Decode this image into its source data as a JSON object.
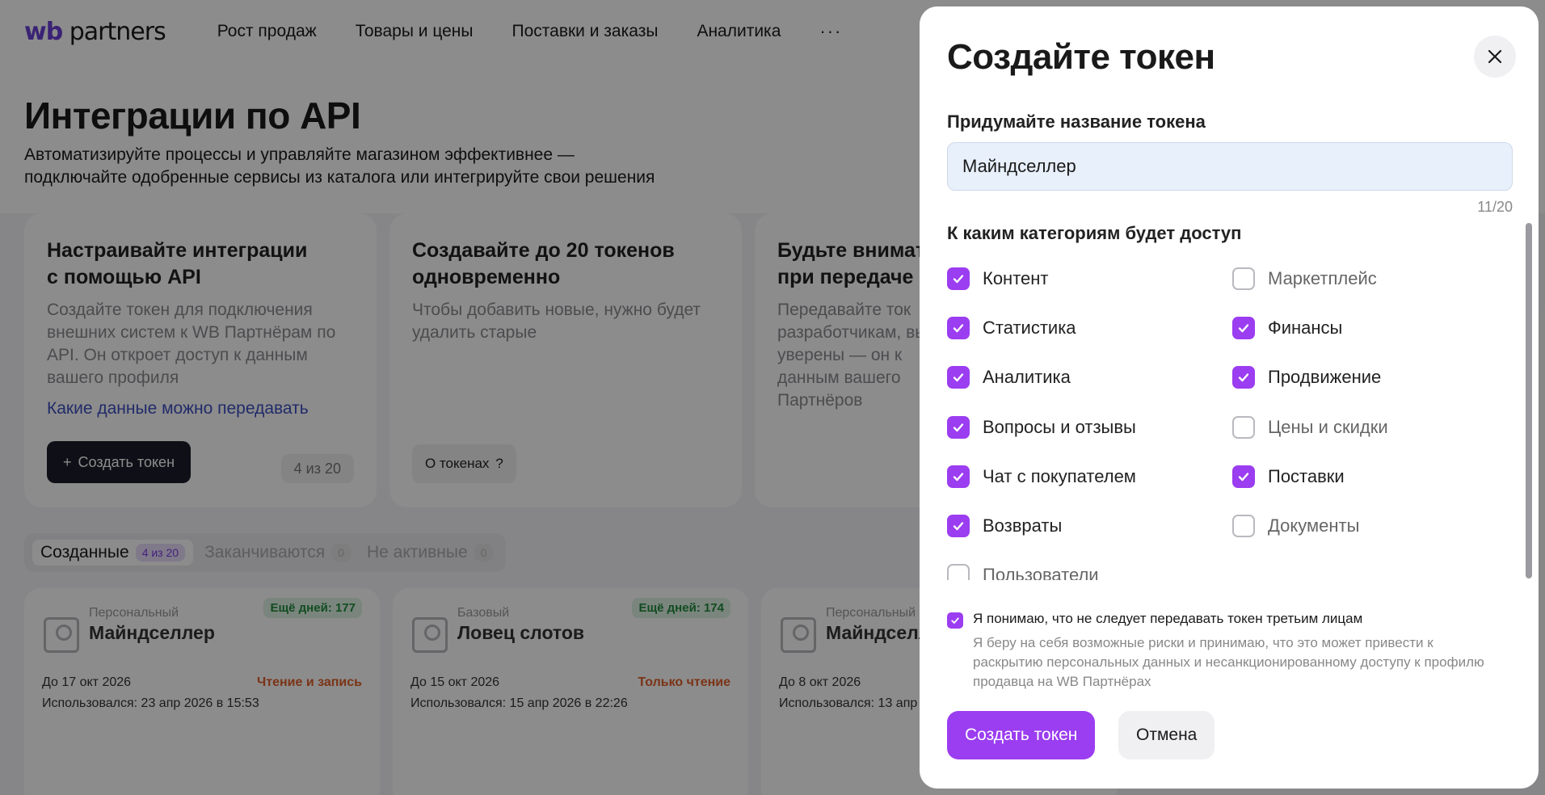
{
  "header": {
    "logo_left": "wb",
    "logo_right": "partners",
    "nav": [
      "Рост продаж",
      "Товары и цены",
      "Поставки и заказы",
      "Аналитика"
    ],
    "more": "···"
  },
  "intro": {
    "title": "Интеграции по API",
    "subtitle_line1": "Автоматизируйте процессы и управляйте магазином эффективнее —",
    "subtitle_line2": "подключайте одобренные сервисы из каталога или интегрируйте свои решения"
  },
  "cards": [
    {
      "title_line1": "Настраивайте интеграции",
      "title_line2": "с помощью API",
      "text": "Создайте токен для подключения внешних систем к WB Партнёрам по API. Он откроет доступ к данным вашего профиля",
      "link": "Какие данные можно передавать",
      "button": "Создать токен",
      "counter": "4 из 20"
    },
    {
      "title_line1": "Создавайте до 20 токенов",
      "title_line2": "одновременно",
      "text": "Чтобы добавить новые, нужно будет удалить старые",
      "button": "О токенах"
    },
    {
      "title_line1": "Будьте внимат",
      "title_line2": "при передаче т",
      "text": "Передавайте ток разработчикам, вы уверены — он к данным вашего Партнёров"
    }
  ],
  "tabs": [
    {
      "label": "Созданные",
      "badge": "4 из 20"
    },
    {
      "label": "Заканчиваются",
      "badge": "0"
    },
    {
      "label": "Не активные",
      "badge": "0"
    }
  ],
  "tokens": [
    {
      "type": "Персональный",
      "name": "Майндселлер",
      "days": "Ещё дней: 177",
      "until": "До 17 окт 2026",
      "mode": "Чтение и запись",
      "used": "Использовался: 23 апр 2026 в 15:53"
    },
    {
      "type": "Базовый",
      "name": "Ловец слотов",
      "days": "Ещё дней: 174",
      "until": "До 15 окт 2026",
      "mode": "Только чтение",
      "used": "Использовался: 15 апр 2026 в 22:26"
    },
    {
      "type": "Персональный",
      "name": "Майндселл",
      "days": "",
      "until": "До 8 окт 2026",
      "mode": "",
      "used": "Использовался: 13 апр 2"
    }
  ],
  "modal": {
    "title": "Создайте токен",
    "name_label": "Придумайте название токена",
    "name_value": "Майндселлер",
    "char_count": "11/20",
    "categories_label": "К каким категориям будет доступ",
    "categories": [
      {
        "label": "Контент",
        "checked": true
      },
      {
        "label": "Маркетплейс",
        "checked": false
      },
      {
        "label": "Статистика",
        "checked": true
      },
      {
        "label": "Финансы",
        "checked": true
      },
      {
        "label": "Аналитика",
        "checked": true
      },
      {
        "label": "Продвижение",
        "checked": true
      },
      {
        "label": "Вопросы и отзывы",
        "checked": true
      },
      {
        "label": "Цены и скидки",
        "checked": false
      },
      {
        "label": "Чат с покупателем",
        "checked": true
      },
      {
        "label": "Поставки",
        "checked": true
      },
      {
        "label": "Возвраты",
        "checked": true
      },
      {
        "label": "Документы",
        "checked": false
      },
      {
        "label": "Пользователи",
        "checked": false
      }
    ],
    "agree_title": "Я понимаю, что не следует передавать токен третьим лицам",
    "agree_note": "Я беру на себя возможные риски и принимаю, что это может привести к раскрытию персональных данных и несанкционированному доступу к профилю продавца на WB Партнёрах",
    "agree_checked": true,
    "submit": "Создать токен",
    "cancel": "Отмена"
  },
  "colors": {
    "accent": "#9b3df0",
    "overlay": "rgba(0,0,0,0.45)"
  }
}
